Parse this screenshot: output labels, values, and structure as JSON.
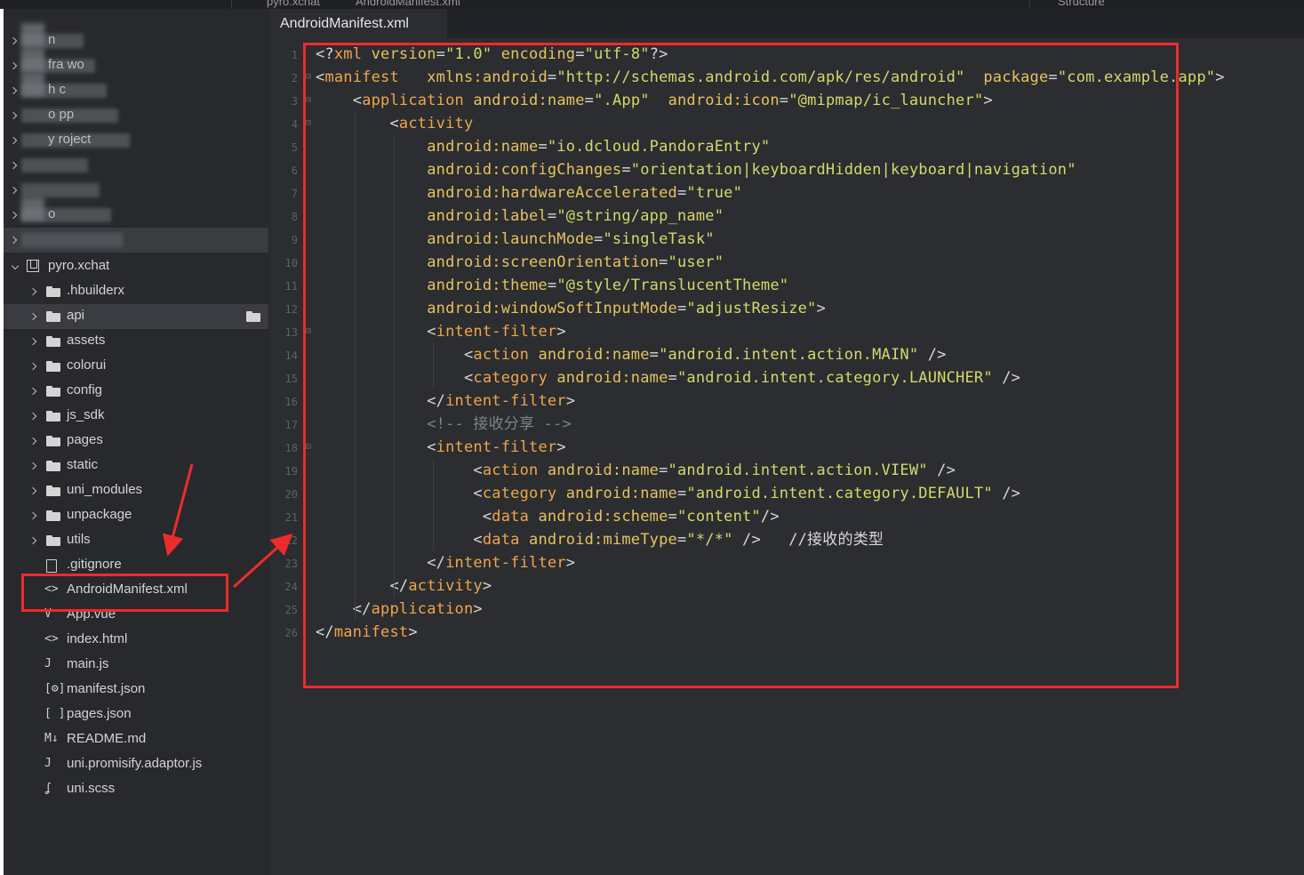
{
  "top_strip": {
    "left_text": "pyro.xchat",
    "mid_text": "AndroidManifest.xml",
    "right_text": "Structure"
  },
  "sidebar": {
    "blurred_items": [
      {
        "visible_fragment": "n"
      },
      {
        "visible_fragment": "fra   wo"
      },
      {
        "visible_fragment": "h   c"
      },
      {
        "visible_fragment": "o   pp"
      },
      {
        "visible_fragment": "y   roject"
      },
      {
        "visible_fragment": ""
      },
      {
        "visible_fragment": ""
      },
      {
        "visible_fragment": "   o"
      },
      {
        "visible_fragment": ""
      }
    ],
    "project": {
      "name": "pyro.xchat",
      "icon": "project-icon"
    },
    "folders": [
      {
        "label": ".hbuilderx"
      },
      {
        "label": "api"
      },
      {
        "label": "assets"
      },
      {
        "label": "colorui"
      },
      {
        "label": "config"
      },
      {
        "label": "js_sdk"
      },
      {
        "label": "pages"
      },
      {
        "label": "static"
      },
      {
        "label": "uni_modules"
      },
      {
        "label": "unpackage"
      },
      {
        "label": "utils"
      }
    ],
    "files": [
      {
        "label": ".gitignore",
        "icon": "file-icon",
        "glyph": ""
      },
      {
        "label": "AndroidManifest.xml",
        "icon": "code-brackets-icon",
        "glyph": "<>"
      },
      {
        "label": "App.vue",
        "icon": "vue-file-icon",
        "glyph": "V"
      },
      {
        "label": "index.html",
        "icon": "code-brackets-icon",
        "glyph": "<>"
      },
      {
        "label": "main.js",
        "icon": "js-file-icon",
        "glyph": "J"
      },
      {
        "label": "manifest.json",
        "icon": "gear-file-icon",
        "glyph": "[⚙]"
      },
      {
        "label": "pages.json",
        "icon": "json-brackets-icon",
        "glyph": "[ ]"
      },
      {
        "label": "README.md",
        "icon": "markdown-icon",
        "glyph": "M↓"
      },
      {
        "label": "uni.promisify.adaptor.js",
        "icon": "js-file-icon",
        "glyph": "J"
      },
      {
        "label": "uni.scss",
        "icon": "scss-icon",
        "glyph": "ʆ"
      }
    ]
  },
  "editor": {
    "tab_title": "AndroidManifest.xml",
    "line_numbers": [
      "1",
      "2",
      "3",
      "4",
      "5",
      "6",
      "7",
      "8",
      "9",
      "10",
      "11",
      "12",
      "13",
      "14",
      "15",
      "16",
      "17",
      "18",
      "19",
      "20",
      "21",
      "22",
      "23",
      "24",
      "25",
      "26"
    ],
    "lines": [
      [
        [
          "p",
          "<?"
        ],
        [
          "t",
          "xml"
        ],
        [
          "p",
          " "
        ],
        [
          "a",
          "version"
        ],
        [
          "p",
          "="
        ],
        [
          "s",
          "\"1.0\""
        ],
        [
          "p",
          " "
        ],
        [
          "a",
          "encoding"
        ],
        [
          "p",
          "="
        ],
        [
          "s",
          "\"utf-8\""
        ],
        [
          "p",
          "?>"
        ]
      ],
      [
        [
          "p",
          "<"
        ],
        [
          "t",
          "manifest"
        ],
        [
          "p",
          "   "
        ],
        [
          "a",
          "xmlns:android"
        ],
        [
          "p",
          "="
        ],
        [
          "s",
          "\"http://schemas.android.com/apk/res/android\""
        ],
        [
          "p",
          "  "
        ],
        [
          "a",
          "package"
        ],
        [
          "p",
          "="
        ],
        [
          "s",
          "\"com.example.app\""
        ],
        [
          "p",
          ">"
        ]
      ],
      [
        [
          "p",
          "    <"
        ],
        [
          "t",
          "application"
        ],
        [
          "p",
          " "
        ],
        [
          "a",
          "android:name"
        ],
        [
          "p",
          "="
        ],
        [
          "s",
          "\".App\""
        ],
        [
          "p",
          "  "
        ],
        [
          "a",
          "android:icon"
        ],
        [
          "p",
          "="
        ],
        [
          "s",
          "\"@mipmap/ic_launcher\""
        ],
        [
          "p",
          ">"
        ]
      ],
      [
        [
          "p",
          "        <"
        ],
        [
          "t",
          "activity"
        ]
      ],
      [
        [
          "p",
          "            "
        ],
        [
          "a",
          "android:name"
        ],
        [
          "p",
          "="
        ],
        [
          "s",
          "\"io.dcloud.PandoraEntry\""
        ]
      ],
      [
        [
          "p",
          "            "
        ],
        [
          "a",
          "android:configChanges"
        ],
        [
          "p",
          "="
        ],
        [
          "s",
          "\"orientation|keyboardHidden|keyboard|navigation\""
        ]
      ],
      [
        [
          "p",
          "            "
        ],
        [
          "a",
          "android:hardwareAccelerated"
        ],
        [
          "p",
          "="
        ],
        [
          "s",
          "\"true\""
        ]
      ],
      [
        [
          "p",
          "            "
        ],
        [
          "a",
          "android:label"
        ],
        [
          "p",
          "="
        ],
        [
          "s",
          "\"@string/app_name\""
        ]
      ],
      [
        [
          "p",
          "            "
        ],
        [
          "a",
          "android:launchMode"
        ],
        [
          "p",
          "="
        ],
        [
          "s",
          "\"singleTask\""
        ]
      ],
      [
        [
          "p",
          "            "
        ],
        [
          "a",
          "android:screenOrientation"
        ],
        [
          "p",
          "="
        ],
        [
          "s",
          "\"user\""
        ]
      ],
      [
        [
          "p",
          "            "
        ],
        [
          "a",
          "android:theme"
        ],
        [
          "p",
          "="
        ],
        [
          "s",
          "\"@style/TranslucentTheme\""
        ]
      ],
      [
        [
          "p",
          "            "
        ],
        [
          "a",
          "android:windowSoftInputMode"
        ],
        [
          "p",
          "="
        ],
        [
          "s",
          "\"adjustResize\""
        ],
        [
          "p",
          ">"
        ]
      ],
      [
        [
          "p",
          "            <"
        ],
        [
          "t",
          "intent-filter"
        ],
        [
          "p",
          ">"
        ]
      ],
      [
        [
          "p",
          "                <"
        ],
        [
          "t",
          "action"
        ],
        [
          "p",
          " "
        ],
        [
          "a",
          "android:name"
        ],
        [
          "p",
          "="
        ],
        [
          "s",
          "\"android.intent.action.MAIN\""
        ],
        [
          "p",
          " />"
        ]
      ],
      [
        [
          "p",
          "                <"
        ],
        [
          "t",
          "category"
        ],
        [
          "p",
          " "
        ],
        [
          "a",
          "android:name"
        ],
        [
          "p",
          "="
        ],
        [
          "s",
          "\"android.intent.category.LAUNCHER\""
        ],
        [
          "p",
          " />"
        ]
      ],
      [
        [
          "p",
          "            </"
        ],
        [
          "t",
          "intent-filter"
        ],
        [
          "p",
          ">"
        ]
      ],
      [
        [
          "c",
          "            <!-- 接收分享 -->"
        ]
      ],
      [
        [
          "p",
          "            <"
        ],
        [
          "t",
          "intent-filter"
        ],
        [
          "p",
          ">"
        ]
      ],
      [
        [
          "p",
          "                 <"
        ],
        [
          "t",
          "action"
        ],
        [
          "p",
          " "
        ],
        [
          "a",
          "android:name"
        ],
        [
          "p",
          "="
        ],
        [
          "s",
          "\"android.intent.action.VIEW\""
        ],
        [
          "p",
          " />"
        ]
      ],
      [
        [
          "p",
          "                 <"
        ],
        [
          "t",
          "category"
        ],
        [
          "p",
          " "
        ],
        [
          "a",
          "android:name"
        ],
        [
          "p",
          "="
        ],
        [
          "s",
          "\"android.intent.category.DEFAULT\""
        ],
        [
          "p",
          " />"
        ]
      ],
      [
        [
          "p",
          "                  <"
        ],
        [
          "t",
          "data"
        ],
        [
          "p",
          " "
        ],
        [
          "a",
          "android:scheme"
        ],
        [
          "p",
          "="
        ],
        [
          "s",
          "\"content\""
        ],
        [
          "p",
          "/>"
        ]
      ],
      [
        [
          "p",
          "                 <"
        ],
        [
          "t",
          "data"
        ],
        [
          "p",
          " "
        ],
        [
          "a",
          "android:mimeType"
        ],
        [
          "p",
          "="
        ],
        [
          "s",
          "\"*/*\""
        ],
        [
          "p",
          " />   //接收的类型"
        ]
      ],
      [
        [
          "p",
          "            </"
        ],
        [
          "t",
          "intent-filter"
        ],
        [
          "p",
          ">"
        ]
      ],
      [
        [
          "p",
          "        </"
        ],
        [
          "t",
          "activity"
        ],
        [
          "p",
          ">"
        ]
      ],
      [
        [
          "p",
          "    </"
        ],
        [
          "t",
          "application"
        ],
        [
          "p",
          ">"
        ]
      ],
      [
        [
          "p",
          "</"
        ],
        [
          "t",
          "manifest"
        ],
        [
          "p",
          ">"
        ]
      ]
    ]
  },
  "colors": {
    "editor_bg": "#2b2d30",
    "sidebar_bg": "#28292c",
    "tag": "#f0a54a",
    "attribute": "#e8c25d",
    "string": "#d6d86a",
    "annotation_red": "#ee2b2b"
  }
}
